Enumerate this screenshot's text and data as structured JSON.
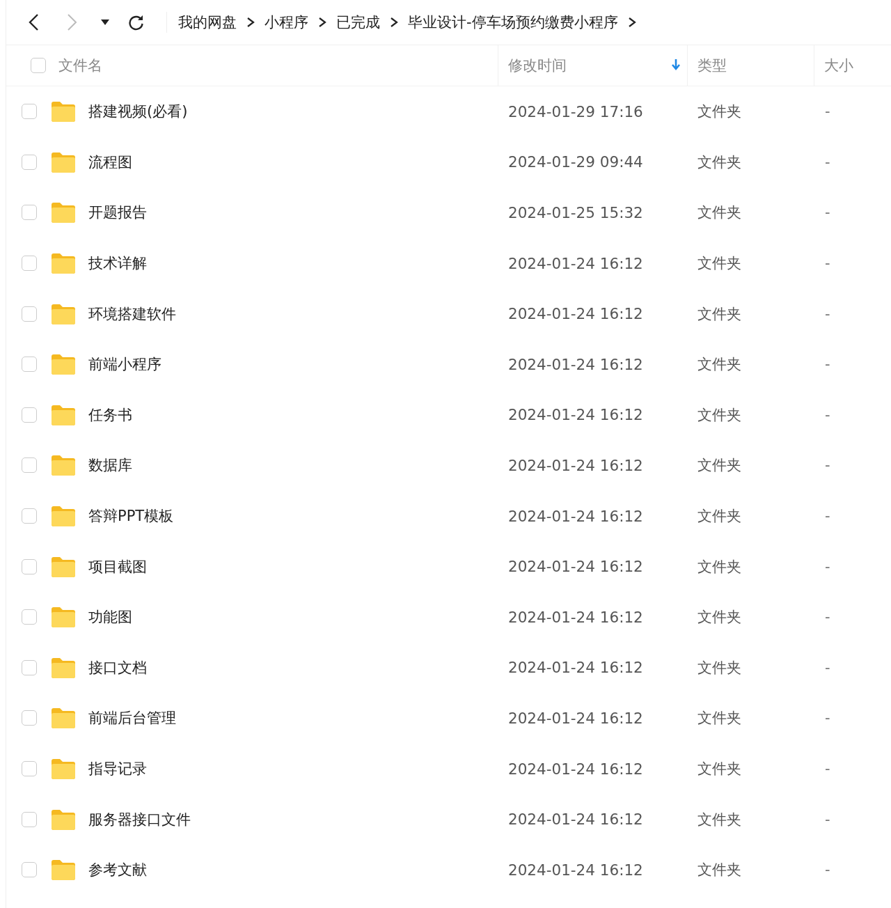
{
  "toolbar": {
    "breadcrumbs": [
      "我的网盘",
      "小程序",
      "已完成",
      "毕业设计-停车场预约缴费小程序"
    ]
  },
  "table": {
    "select_all": {
      "checked": false
    },
    "columns": [
      {
        "label": "文件名",
        "sorted": false
      },
      {
        "label": "修改时间",
        "sorted": true
      },
      {
        "label": "类型",
        "sorted": false
      },
      {
        "label": "大小",
        "sorted": false
      }
    ],
    "rows": [
      {
        "name": "搭建视频(必看)",
        "modified": "2024-01-29 17:16",
        "type": "文件夹",
        "size": "-",
        "checked": false
      },
      {
        "name": "流程图",
        "modified": "2024-01-29 09:44",
        "type": "文件夹",
        "size": "-",
        "checked": false
      },
      {
        "name": "开题报告",
        "modified": "2024-01-25 15:32",
        "type": "文件夹",
        "size": "-",
        "checked": false
      },
      {
        "name": "技术详解",
        "modified": "2024-01-24 16:12",
        "type": "文件夹",
        "size": "-",
        "checked": false
      },
      {
        "name": "环境搭建软件",
        "modified": "2024-01-24 16:12",
        "type": "文件夹",
        "size": "-",
        "checked": false
      },
      {
        "name": "前端小程序",
        "modified": "2024-01-24 16:12",
        "type": "文件夹",
        "size": "-",
        "checked": false
      },
      {
        "name": "任务书",
        "modified": "2024-01-24 16:12",
        "type": "文件夹",
        "size": "-",
        "checked": false
      },
      {
        "name": "数据库",
        "modified": "2024-01-24 16:12",
        "type": "文件夹",
        "size": "-",
        "checked": false
      },
      {
        "name": "答辩PPT模板",
        "modified": "2024-01-24 16:12",
        "type": "文件夹",
        "size": "-",
        "checked": false
      },
      {
        "name": "项目截图",
        "modified": "2024-01-24 16:12",
        "type": "文件夹",
        "size": "-",
        "checked": false
      },
      {
        "name": "功能图",
        "modified": "2024-01-24 16:12",
        "type": "文件夹",
        "size": "-",
        "checked": false
      },
      {
        "name": "接口文档",
        "modified": "2024-01-24 16:12",
        "type": "文件夹",
        "size": "-",
        "checked": false
      },
      {
        "name": "前端后台管理",
        "modified": "2024-01-24 16:12",
        "type": "文件夹",
        "size": "-",
        "checked": false
      },
      {
        "name": "指导记录",
        "modified": "2024-01-24 16:12",
        "type": "文件夹",
        "size": "-",
        "checked": false
      },
      {
        "name": "服务器接口文件",
        "modified": "2024-01-24 16:12",
        "type": "文件夹",
        "size": "-",
        "checked": false
      },
      {
        "name": "参考文献",
        "modified": "2024-01-24 16:12",
        "type": "文件夹",
        "size": "-",
        "checked": false
      }
    ]
  }
}
